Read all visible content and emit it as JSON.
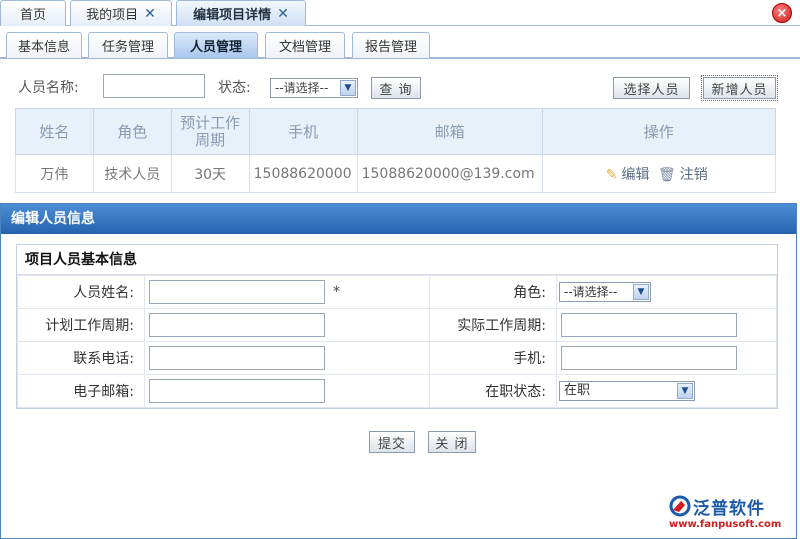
{
  "top_tabs": [
    {
      "label": "首页"
    },
    {
      "label": "我的项目",
      "close": "✕"
    },
    {
      "label": "编辑项目详情",
      "close": "✕"
    }
  ],
  "close_all_icon": "×",
  "sub_tabs": [
    "基本信息",
    "任务管理",
    "人员管理",
    "文档管理",
    "报告管理"
  ],
  "search": {
    "name_label": "人员名称:",
    "status_label": "状态:",
    "status_selected": "--请选择--",
    "query_button": "查 询",
    "select_people_button": "选择人员",
    "add_person_button": "新增人员"
  },
  "people_table": {
    "columns": [
      "姓名",
      "角色",
      "预计工作周期",
      "手机",
      "邮箱",
      "操作"
    ],
    "rows": [
      {
        "name": "万伟",
        "role": "技术人员",
        "period": "30天",
        "mobile": "15088620000",
        "email": "15088620000@139.com",
        "edit": "编辑",
        "cancel": "注销"
      }
    ]
  },
  "modal": {
    "title": "编辑人员信息",
    "section_title": "项目人员基本信息",
    "fields": {
      "name_label": "人员姓名:",
      "required_mark": "*",
      "role_label": "角色:",
      "role_selected": "--请选择--",
      "planned_label": "计划工作周期:",
      "actual_label": "实际工作周期:",
      "phone_label": "联系电话:",
      "mobile_label": "手机:",
      "email_label": "电子邮箱:",
      "status_label": "在职状态:",
      "status_selected": "在职"
    },
    "submit_button": "提交",
    "close_button": "关 闭"
  },
  "logo": {
    "name": "泛普软件",
    "url": "www.fanpusoft.com"
  },
  "colors": {
    "header_blue": "#2e6fb9",
    "logo_blue": "#1a5aa8",
    "logo_red": "#d01c1c"
  }
}
